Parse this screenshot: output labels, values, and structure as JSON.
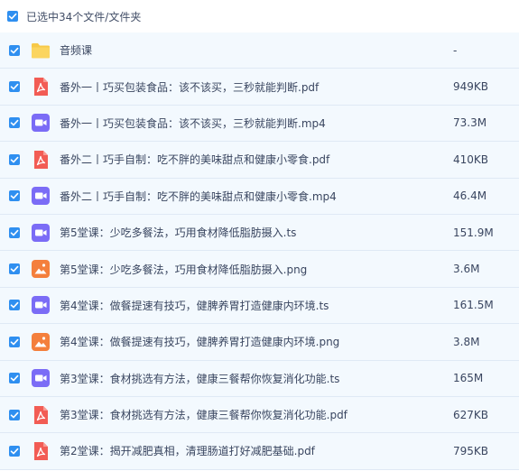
{
  "header": {
    "selection_text": "已选中34个文件/文件夹"
  },
  "files": [
    {
      "name": "音频课",
      "size": "-",
      "type": "folder-icon"
    },
    {
      "name": "番外一丨巧买包装食品：该不该买，三秒就能判断.pdf",
      "size": "949KB",
      "type": "pdf-icon"
    },
    {
      "name": "番外一丨巧买包装食品：该不该买，三秒就能判断.mp4",
      "size": "73.3M",
      "type": "video-icon"
    },
    {
      "name": "番外二丨巧手自制：吃不胖的美味甜点和健康小零食.pdf",
      "size": "410KB",
      "type": "pdf-icon"
    },
    {
      "name": "番外二丨巧手自制：吃不胖的美味甜点和健康小零食.mp4",
      "size": "46.4M",
      "type": "video-icon"
    },
    {
      "name": "第5堂课：少吃多餐法，巧用食材降低脂肪摄入.ts",
      "size": "151.9M",
      "type": "video-icon"
    },
    {
      "name": "第5堂课：少吃多餐法，巧用食材降低脂肪摄入.png",
      "size": "3.6M",
      "type": "image-icon"
    },
    {
      "name": "第4堂课：做餐提速有技巧，健脾养胃打造健康内环境.ts",
      "size": "161.5M",
      "type": "video-icon"
    },
    {
      "name": "第4堂课：做餐提速有技巧，健脾养胃打造健康内环境.png",
      "size": "3.8M",
      "type": "image-icon"
    },
    {
      "name": "第3堂课：食材挑选有方法，健康三餐帮你恢复消化功能.ts",
      "size": "165M",
      "type": "video-icon"
    },
    {
      "name": "第3堂课：食材挑选有方法，健康三餐帮你恢复消化功能.pdf",
      "size": "627KB",
      "type": "pdf-icon"
    },
    {
      "name": "第2堂课：揭开减肥真相，清理肠道打好减肥基础.pdf",
      "size": "795KB",
      "type": "pdf-icon"
    }
  ],
  "colors": {
    "checkbox": "#2f8ff0",
    "folder": "#f7c948",
    "pdf": "#f25c54",
    "video": "#7b6cf6",
    "image": "#f47f3c"
  }
}
